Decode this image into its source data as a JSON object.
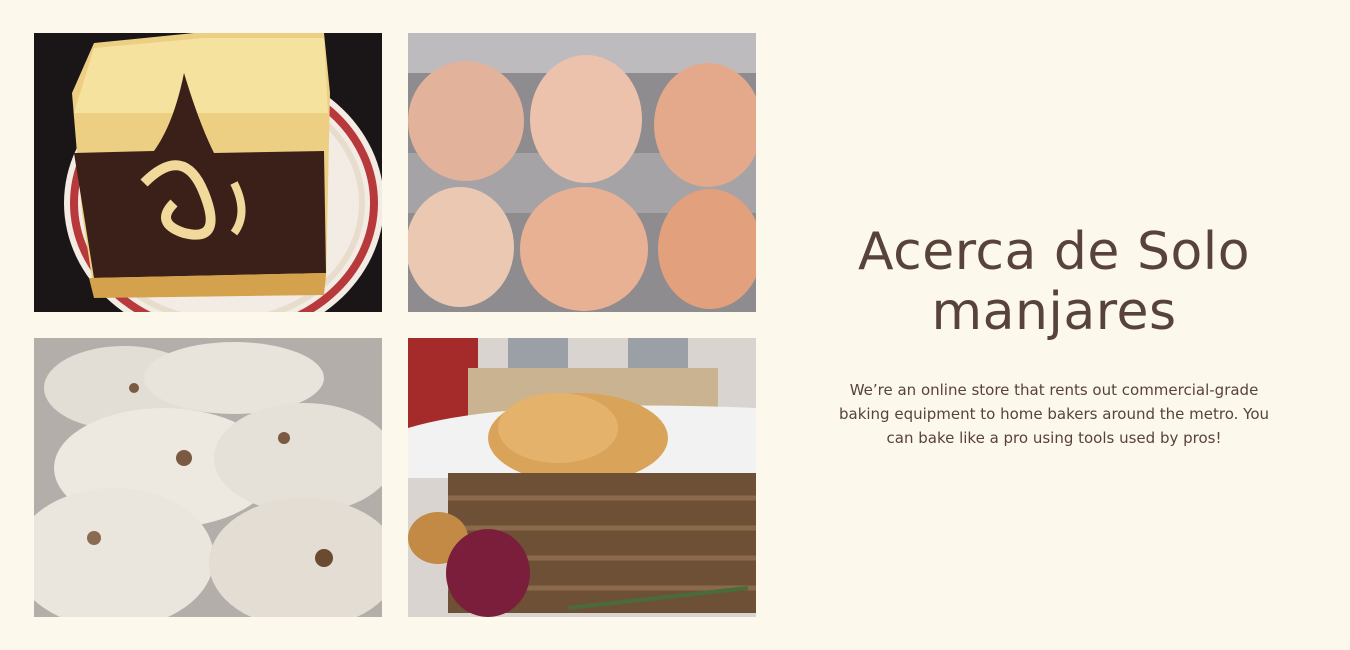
{
  "about": {
    "heading": "Acerca de Solo manjares",
    "description": "We’re an online store that rents out commercial-grade baking equipment to home bakers around the metro. You can bake like a pro using tools used by pros!"
  },
  "gallery": [
    {
      "subject": "marble-pound-cake"
    },
    {
      "subject": "eggs-in-carton"
    },
    {
      "subject": "flatbread"
    },
    {
      "subject": "bread-basket"
    }
  ],
  "colors": {
    "background": "#fdf8ec",
    "text": "#58433a"
  }
}
